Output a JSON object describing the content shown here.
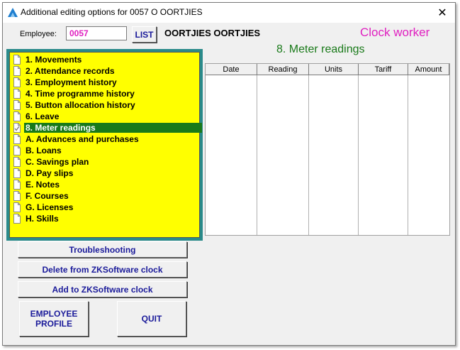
{
  "window": {
    "title": "Additional editing options for 0057 O OORTJIES",
    "close_glyph": "✕"
  },
  "employee": {
    "label": "Employee:",
    "value": "0057",
    "list_label": "LIST",
    "name": "OORTJIES OORTJIES",
    "status": "Clock worker"
  },
  "section_title": "8. Meter readings",
  "menu": {
    "items": [
      {
        "label": "1. Movements",
        "icon": "document-icon"
      },
      {
        "label": "2. Attendance records",
        "icon": "document-icon"
      },
      {
        "label": "3. Employment history",
        "icon": "document-icon"
      },
      {
        "label": "4. Time programme history",
        "icon": "document-icon"
      },
      {
        "label": "5. Button allocation history",
        "icon": "document-icon"
      },
      {
        "label": "6. Leave",
        "icon": "document-icon"
      },
      {
        "label": "8. Meter readings",
        "icon": "document-checked-icon",
        "selected": true
      },
      {
        "label": "A. Advances and purchases",
        "icon": "document-icon"
      },
      {
        "label": "B. Loans",
        "icon": "document-icon"
      },
      {
        "label": "C. Savings plan",
        "icon": "document-icon"
      },
      {
        "label": "D. Pay slips",
        "icon": "document-icon"
      },
      {
        "label": "E. Notes",
        "icon": "document-icon"
      },
      {
        "label": "F. Courses",
        "icon": "document-icon"
      },
      {
        "label": "G. Licenses",
        "icon": "document-icon"
      },
      {
        "label": "H. Skills",
        "icon": "document-icon"
      }
    ]
  },
  "grid": {
    "columns": [
      "Date",
      "Reading",
      "Units",
      "Tariff",
      "Amount"
    ],
    "rows": []
  },
  "buttons": {
    "troubleshooting": "Troubleshooting",
    "delete_clock": "Delete from ZKSoftware clock",
    "add_clock": "Add to ZKSoftware clock",
    "employee_profile": "EMPLOYEE PROFILE",
    "quit": "QUIT"
  },
  "colors": {
    "menu_background": "#ffff00",
    "selected_background": "#1a7a1a",
    "accent_magenta": "#e020c0",
    "section_green": "#1a7a1a",
    "button_text": "#1a1a9a"
  }
}
